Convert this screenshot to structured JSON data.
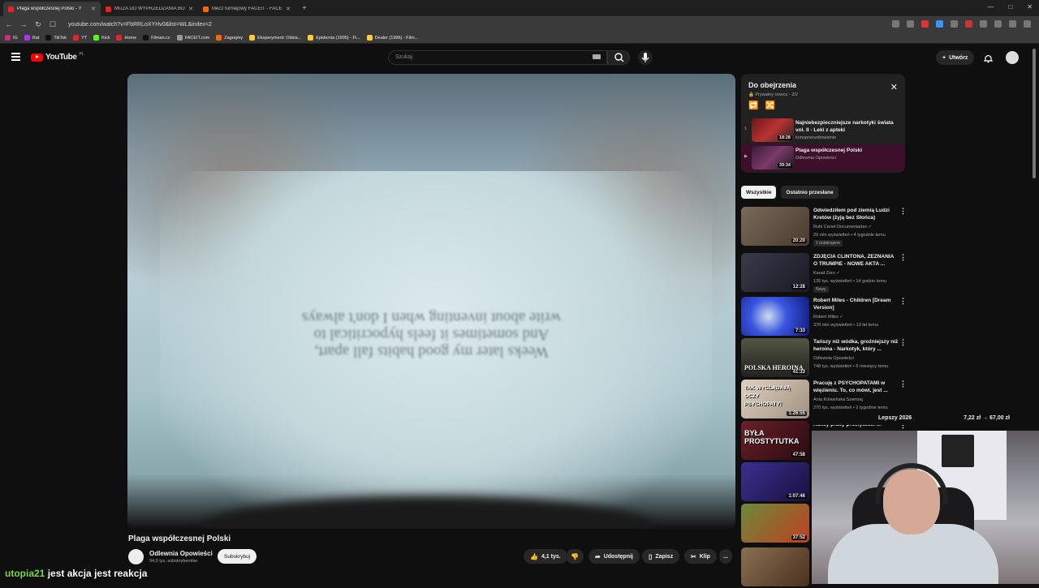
{
  "browser": {
    "tabs": [
      {
        "label": "Plaga współczesnej Polski - Y",
        "active": true
      },
      {
        "label": "MUZA DO WYPRZEDZANIA BO...",
        "active": false
      },
      {
        "label": "Mecz turniejowy FACEIT - FACEIT.com",
        "active": false
      }
    ],
    "url": "youtube.com/watch?v=FbRRLoXYHv0&list=WL&index=2",
    "bookmarks": [
      "IG",
      "Rat",
      "TikTok",
      "YT",
      "Kick",
      "Home",
      "Filman.cc",
      "FACEIT.com",
      "Zagrajmy",
      "Eksperyment: Odsia...",
      "Epidemia (1995) - Fi...",
      "Dealer (1996) - Film..."
    ]
  },
  "header": {
    "logo": "YouTube",
    "region": "PL",
    "search_placeholder": "Szukaj",
    "create_label": "Utwórz"
  },
  "player": {
    "mirrored_text": [
      "Weeks later my good habits fall apart,",
      "And sometimes it feels hypocritical to",
      "write about inventing when I don't always"
    ]
  },
  "video": {
    "title": "Plaga współczesnej Polski",
    "channel": "Odlewnia Opowieści",
    "subscribers": "94,9 tys. subskrybentów",
    "subscribe_label": "Subskrybuj",
    "likes": "4,1 tys.",
    "share_label": "Udostępnij",
    "save_label": "Zapisz",
    "clip_label": "Klip",
    "more": "..."
  },
  "playlist": {
    "title": "Do obejrzenia",
    "meta": "Prywatny nowcu - 2/2",
    "items": [
      {
        "index": "1",
        "title": "Najniebezpieczniejsze narkotyki świata vol. II - Leki z apteki",
        "channel": "konopneszdrowienie",
        "duration": "18:28"
      },
      {
        "index": "▶",
        "title": "Plaga współczesnej Polski",
        "channel": "Odlewnia Opowieści",
        "duration": "39:34"
      }
    ]
  },
  "chips": [
    "Wszystkie",
    "Ostatnio przesłane"
  ],
  "recommendations": [
    {
      "title": "Odwiedziłem pod ziemią Ludzi Kretów (żyją bez Słońca)",
      "channel": "Ruhi Cenet Documentaries ✓",
      "meta": "29 mln wyświetleń • 4 tygodnie temu",
      "badge": "2 dubbingiem",
      "duration": "20:20",
      "thumb_color": "#6b5a4a",
      "thumb_text": ""
    },
    {
      "title": "ZDJĘCIA CLINTONA, ZEZNANIA O TRUMPIE - NOWE AKTA ...",
      "channel": "Kanał Zero ✓",
      "meta": "135 tys. wyświetleń • 14 godzin temu",
      "badge": "Nowy",
      "duration": "12:28",
      "thumb_color": "#2c2c3a",
      "thumb_text": ""
    },
    {
      "title": "Robert Miles - Children [Dream Version]",
      "channel": "Robert Miles ✓",
      "meta": "378 mln wyświetleń • 13 lat temu",
      "badge": "",
      "duration": "7:33",
      "thumb_color": "#2a3fd0",
      "thumb_text": ""
    },
    {
      "title": "Tańszy niż wódka, groźniejszy niż heroina - Narkotyk, który ...",
      "channel": "Odlewnia Opowieści",
      "meta": "748 tys. wyświetleń • 6 miesięcy temu",
      "badge": "",
      "duration": "41:33",
      "thumb_color": "#3a3a2e",
      "thumb_text": "POLSKA HEROINA"
    },
    {
      "title": "Pracuję z PSYCHOPATAMI w więzieniu. To, co mówi, jest ...",
      "channel": "Ania Kolasińska Szemraj",
      "meta": "270 tys. wyświetleń • 2 tygodnie temu",
      "badge": "",
      "duration": "1:26:55",
      "thumb_color": "#c9b9a6",
      "thumb_text": "TAK WYGLĄDAJĄ OCZY PSYCHOPATY!"
    },
    {
      "title": "Kulisy pracy prostytutki. ...",
      "channel": "",
      "meta": "",
      "badge": "",
      "duration": "47:58",
      "thumb_color": "#4a1b1f",
      "thumb_text": "BYŁA PROSTYTUTKA"
    },
    {
      "title": "",
      "channel": "",
      "meta": "",
      "badge": "",
      "duration": "1:07:46",
      "thumb_color": "#2e2a6a",
      "thumb_text": ""
    },
    {
      "title": "",
      "channel": "",
      "meta": "",
      "badge": "",
      "duration": "37:52",
      "thumb_color": "#5a7a3a",
      "thumb_text": ""
    }
  ],
  "stream_overlay": {
    "username": "utopia21",
    "message": "jest akcja jest reakcja",
    "cam_left": "Lepszy 2026",
    "cam_right": "7,22 zł → 67,00 zł"
  }
}
